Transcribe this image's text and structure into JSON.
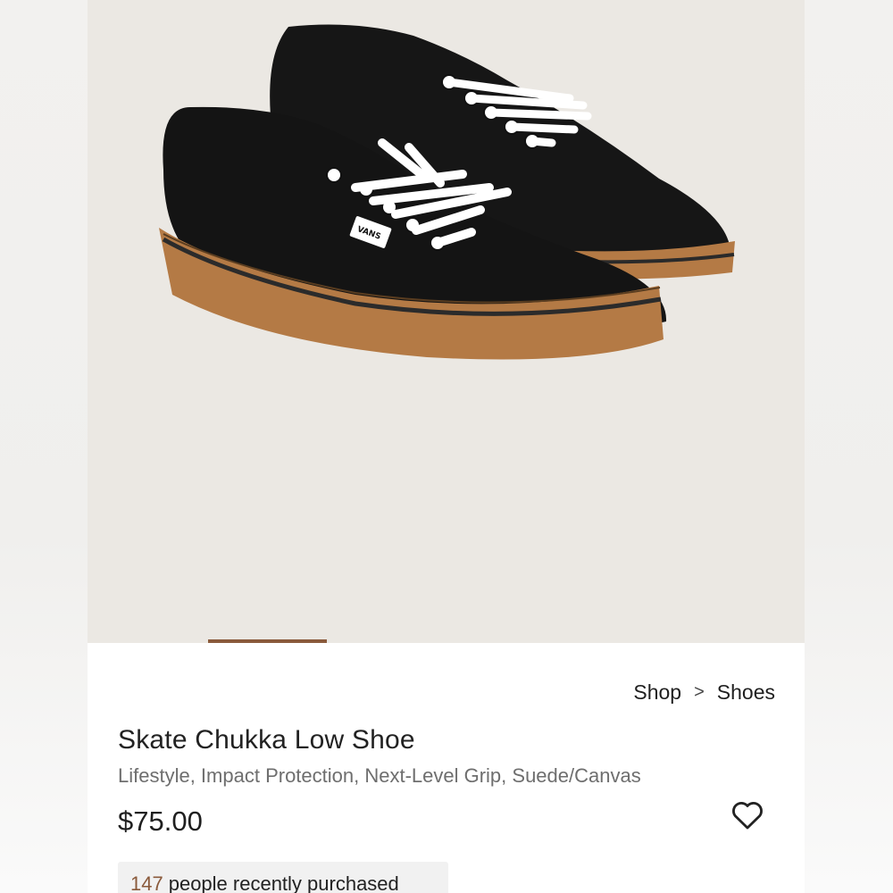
{
  "breadcrumb": {
    "items": [
      "Shop",
      "Shoes"
    ],
    "separator": ">"
  },
  "product": {
    "title": "Skate Chukka Low Shoe",
    "features": "Lifestyle, Impact Protection, Next-Level Grip, Suede/Canvas",
    "price": "$75.00",
    "recently_purchased_count": "147",
    "recently_purchased_text": "people recently purchased",
    "brand_tag": "VANS"
  },
  "carousel": {
    "active_index": 1
  },
  "icons": {
    "wishlist": "heart-outline-icon",
    "breadcrumb_separator": "chevron-right-icon"
  },
  "colors": {
    "accent": "#8a5a3b",
    "hero_bg": "#ebe8e3",
    "shoe_upper": "#141414",
    "shoe_sole": "#b47a45"
  }
}
